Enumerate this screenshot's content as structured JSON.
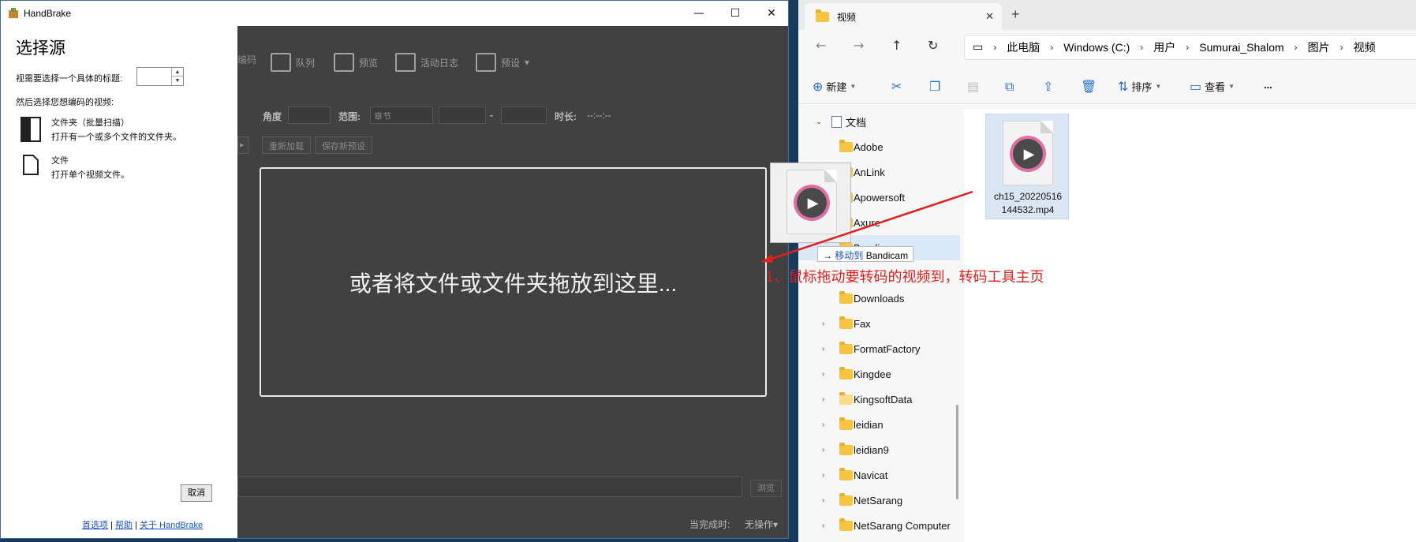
{
  "handbrake": {
    "window_title": "HandBrake",
    "toolbar": [
      "编码",
      "队列",
      "预览",
      "活动日志",
      "预设"
    ],
    "row_labels": {
      "angle": "角度",
      "range": "范围:",
      "range_value": "章节",
      "dash": "-",
      "duration": "时长:",
      "duration_value": "--:--:--"
    },
    "buttons": {
      "reload": "重新加载",
      "save_preset": "保存新预设",
      "browse": "浏览"
    },
    "drop_text": "或者将文件或文件夹拖放到这里...",
    "status": {
      "when_done": "当完成时:",
      "when_done_value": "无操作"
    }
  },
  "source_panel": {
    "heading": "选择源",
    "title_prompt": "视需要选择一个具体的标题:",
    "then_prompt": "然后选择您想编码的视频:",
    "options": [
      {
        "icon": "folder-scan-icon",
        "title": "文件夹（批量扫描）",
        "desc": "打开有一个或多个文件的文件夹。"
      },
      {
        "icon": "file-icon",
        "title": "文件",
        "desc": "打开单个视频文件。"
      }
    ],
    "cancel": "取消",
    "links": {
      "preferences": "首选项",
      "sep": "|",
      "help": "帮助",
      "about": "关于 HandBrake"
    }
  },
  "explorer": {
    "tab_title": "视频",
    "breadcrumb": [
      "此电脑",
      "Windows (C:)",
      "用户",
      "Sumurai_Shalom",
      "图片",
      "视频"
    ],
    "commands": {
      "new": "新建",
      "sort": "排序",
      "view": "查看",
      "more": "..."
    },
    "nav_items": [
      {
        "label": "文档",
        "expanded": true,
        "icon": "document-icon"
      },
      {
        "label": "Adobe"
      },
      {
        "label": "AnLink"
      },
      {
        "label": "Apowersoft"
      },
      {
        "label": "Axure"
      },
      {
        "label": "Bandicam"
      },
      {
        "label": "Downloads"
      },
      {
        "label": "Fax"
      },
      {
        "label": "FormatFactory"
      },
      {
        "label": "Kingdee"
      },
      {
        "label": "KingsoftData"
      },
      {
        "label": "leidian"
      },
      {
        "label": "leidian9"
      },
      {
        "label": "Navicat"
      },
      {
        "label": "NetSarang"
      },
      {
        "label": "NetSarang Computer"
      }
    ],
    "file": {
      "name_line1": "ch15_20220516",
      "name_line2": "144532.mp4",
      "icon": "video-file-icon"
    }
  },
  "drag": {
    "tooltip_prefix": "→",
    "tooltip_action": "移动到",
    "tooltip_target": "Bandicam",
    "annotation": "1、鼠标拖动要转码的视频到，转码工具主页"
  },
  "colors": {
    "annotation": "#e0201e",
    "link": "#1a53c7",
    "selection": "#dbe9f8"
  }
}
